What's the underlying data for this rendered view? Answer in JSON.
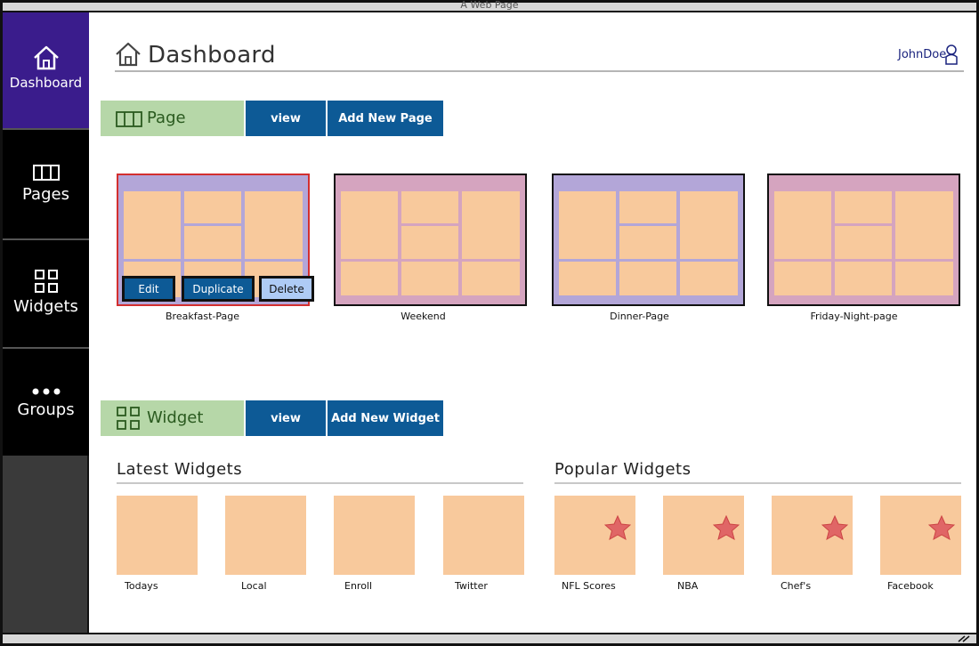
{
  "window": {
    "title": "A Web Page"
  },
  "sidebar": {
    "items": [
      {
        "label": "Dashboard",
        "icon": "home-icon",
        "active": true
      },
      {
        "label": "Pages",
        "icon": "columns-icon"
      },
      {
        "label": "Widgets",
        "icon": "grid-icon"
      },
      {
        "label": "Groups",
        "icon": "more-dots-icon"
      }
    ]
  },
  "header": {
    "title": "Dashboard",
    "user": "JohnDoe"
  },
  "page_section": {
    "label": "Page",
    "view_label": "view",
    "add_label": "Add New Page",
    "thumbnails": [
      {
        "name": "Breakfast-Page",
        "theme": "purple",
        "selected": true
      },
      {
        "name": "Weekend",
        "theme": "pink"
      },
      {
        "name": "Dinner-Page",
        "theme": "purple"
      },
      {
        "name": "Friday-Night-page",
        "theme": "pink"
      }
    ],
    "actions": {
      "edit": "Edit",
      "duplicate": "Duplicate",
      "delete": "Delete"
    }
  },
  "widget_section": {
    "label": "Widget",
    "view_label": "view",
    "add_label": "Add New Widget",
    "latest_title": "Latest Widgets",
    "popular_title": "Popular Widgets",
    "latest": [
      "Todays",
      "Local",
      "Enroll",
      "Twitter"
    ],
    "popular": [
      "NFL Scores",
      "NBA",
      "Chef's",
      "Facebook"
    ]
  },
  "colors": {
    "sidebar_active": "#3a1c8c",
    "button_blue": "#0d5a96",
    "section_green": "#b6d7a8",
    "tile_peach": "#f8c99c",
    "star_red": "#e06666"
  }
}
